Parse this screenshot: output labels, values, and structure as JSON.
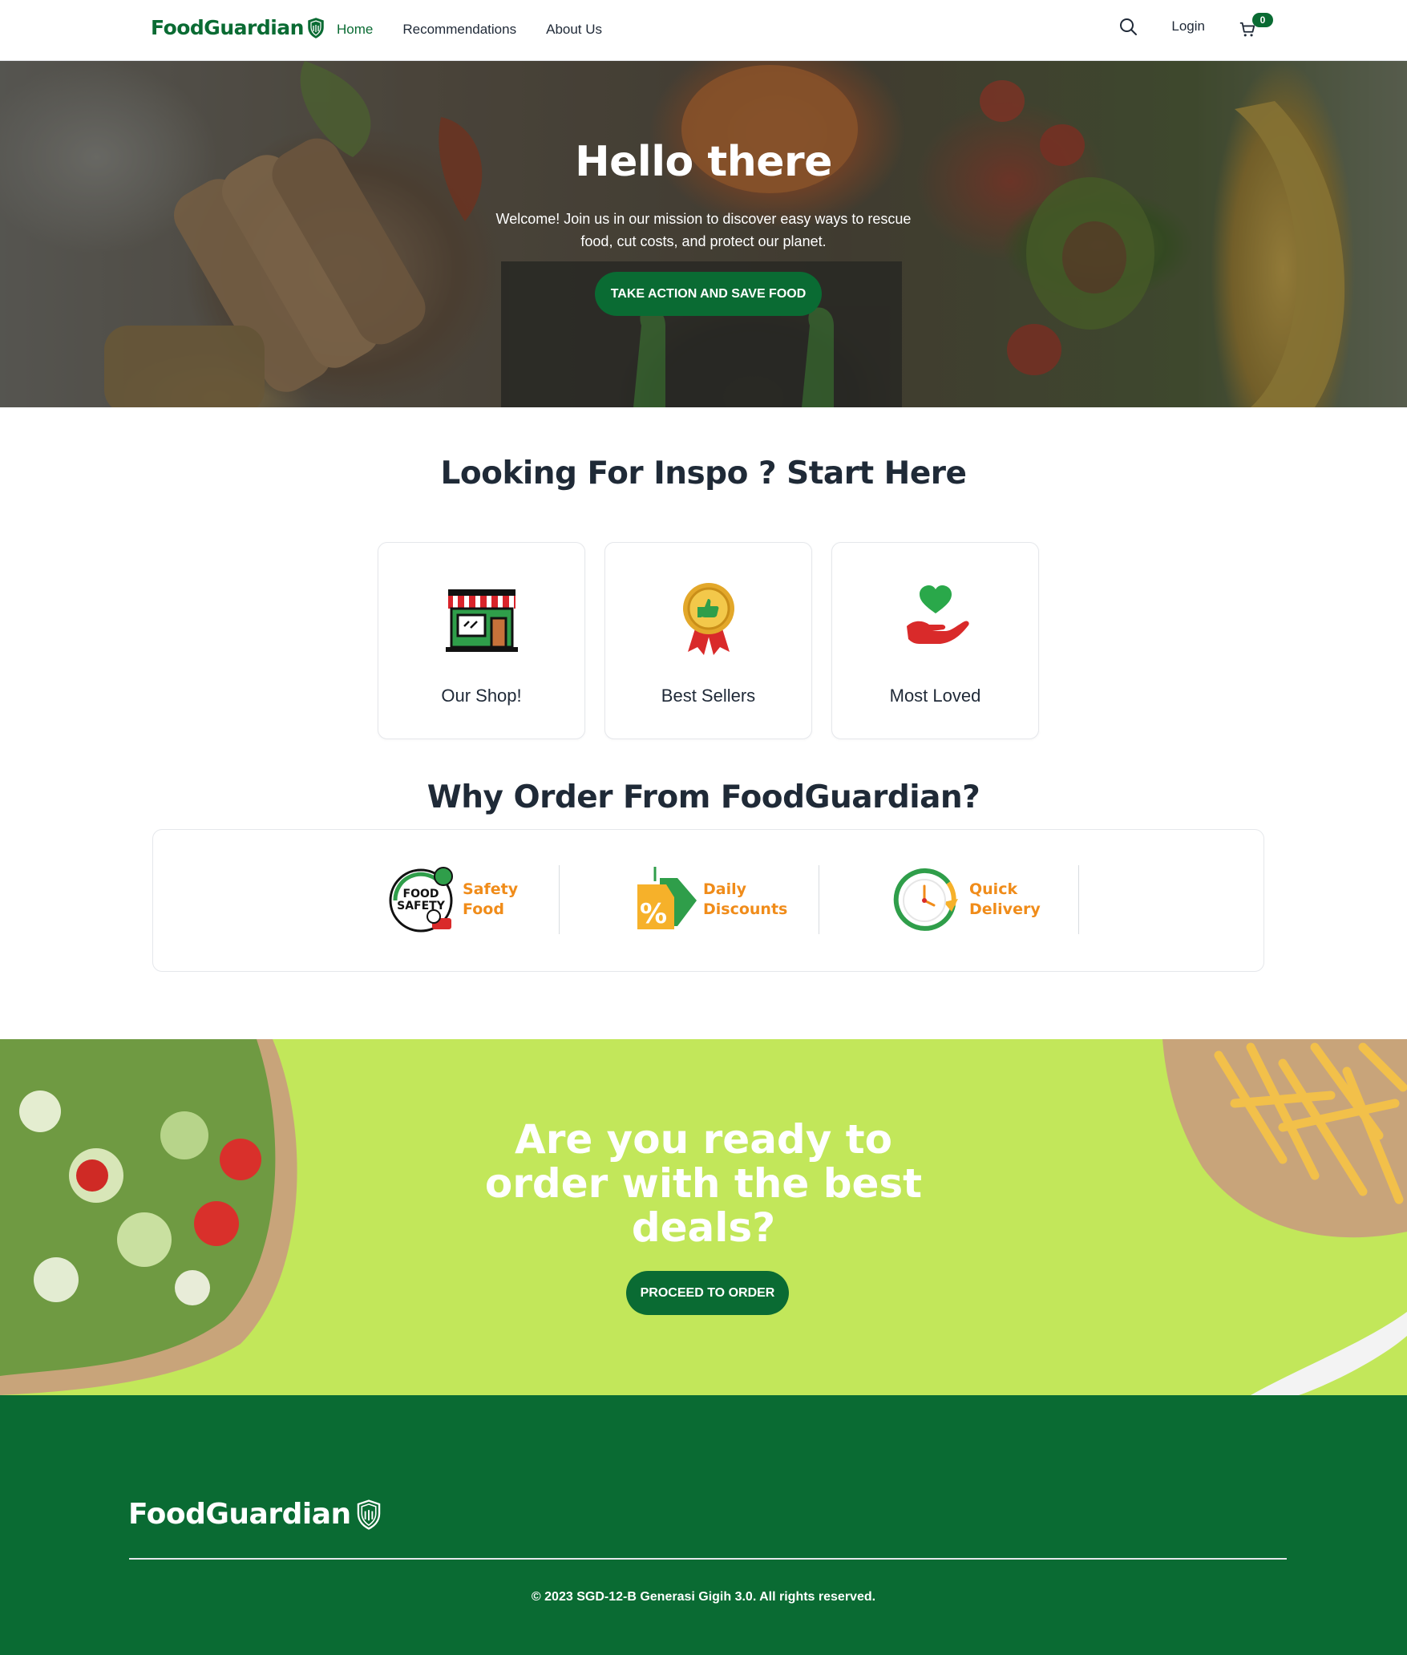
{
  "brand": {
    "name": "FoodGuardian",
    "color": "#0a6b33",
    "accent": "#f08c1a",
    "cta_bg": "#c2e75a"
  },
  "nav": {
    "links": [
      {
        "label": "Home",
        "active": true
      },
      {
        "label": "Recommendations",
        "active": false
      },
      {
        "label": "About Us",
        "active": false
      }
    ],
    "login_label": "Login",
    "cart_count": "0",
    "search_icon": "search-icon",
    "cart_icon": "cart-icon"
  },
  "hero": {
    "title": "Hello there",
    "subtitle": "Welcome! Join us in our mission to discover easy ways to rescue food, cut costs, and protect our planet.",
    "button_label": "TAKE ACTION AND SAVE FOOD"
  },
  "inspo": {
    "title": "Looking For Inspo ? Start Here",
    "cards": [
      {
        "label": "Our Shop!",
        "icon": "shop-icon"
      },
      {
        "label": "Best Sellers",
        "icon": "badge-icon"
      },
      {
        "label": "Most Loved",
        "icon": "heart-hand-icon"
      }
    ]
  },
  "why": {
    "title": "Why Order From FoodGuardian?",
    "features": [
      {
        "line1": "Safety",
        "line2": "Food",
        "icon": "food-safety-icon",
        "badge_line1": "FOOD",
        "badge_line2": "SAFETY"
      },
      {
        "line1": "Daily",
        "line2": "Discounts",
        "icon": "discount-tag-icon",
        "badge_text": "%"
      },
      {
        "line1": "Quick",
        "line2": "Delivery",
        "icon": "clock-icon"
      }
    ]
  },
  "cta": {
    "title": "Are you ready to order with the best deals?",
    "button_label": "PROCEED TO ORDER"
  },
  "footer": {
    "brand": "FoodGuardian",
    "copyright": "© 2023 SGD-12-B Generasi Gigih 3.0. All rights reserved."
  }
}
